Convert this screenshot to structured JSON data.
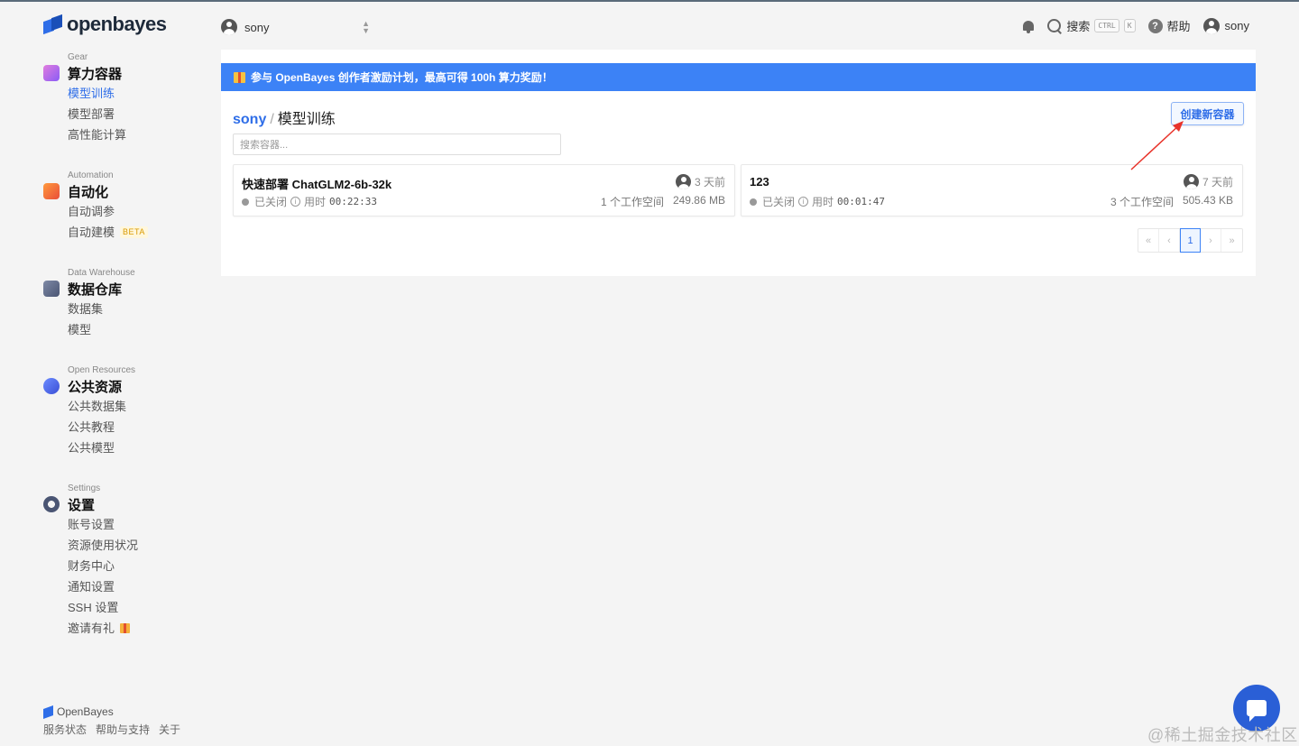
{
  "brand": {
    "name": "openbayes"
  },
  "topbar": {
    "user_switch": "sony",
    "search_label": "搜索",
    "kbd_ctrl": "CTRL",
    "kbd_k": "K",
    "help_label": "帮助",
    "me_label": "sony"
  },
  "sidebar": {
    "gear": {
      "sub": "Gear",
      "title": "算力容器",
      "items": [
        "模型训练",
        "模型部署",
        "高性能计算"
      ]
    },
    "automation": {
      "sub": "Automation",
      "title": "自动化",
      "items": [
        "自动调参",
        "自动建模"
      ],
      "beta": "BETA"
    },
    "warehouse": {
      "sub": "Data Warehouse",
      "title": "数据仓库",
      "items": [
        "数据集",
        "模型"
      ]
    },
    "open": {
      "sub": "Open Resources",
      "title": "公共资源",
      "items": [
        "公共数据集",
        "公共教程",
        "公共模型"
      ]
    },
    "settings": {
      "sub": "Settings",
      "title": "设置",
      "items": [
        "账号设置",
        "资源使用状况",
        "财务中心",
        "通知设置",
        "SSH 设置",
        "邀请有礼"
      ]
    }
  },
  "footer": {
    "brand": "OpenBayes",
    "links": [
      "服务状态",
      "帮助与支持",
      "关于"
    ]
  },
  "banner": {
    "text": "参与 OpenBayes 创作者激励计划，最高可得 100h 算力奖励！"
  },
  "breadcrumb": {
    "owner": "sony",
    "sep": "/",
    "page": "模型训练"
  },
  "create_button": "创建新容器",
  "search": {
    "placeholder": "搜索容器..."
  },
  "containers": [
    {
      "title": "快速部署 ChatGLM2-6b-32k",
      "status": "已关闭",
      "duration_label": "用时",
      "duration": "00:22:33",
      "time": "3 天前",
      "workspaces": "1 个工作空间",
      "size": "249.86 MB"
    },
    {
      "title": "123",
      "status": "已关闭",
      "duration_label": "用时",
      "duration": "00:01:47",
      "time": "7 天前",
      "workspaces": "3 个工作空间",
      "size": "505.43 KB"
    }
  ],
  "pagination": {
    "first": "«",
    "prev": "‹",
    "current": "1",
    "next": "›",
    "last": "»"
  },
  "watermark": "@稀土掘金技术社区",
  "colors": {
    "accent": "#3c82f6",
    "link": "#2f6ee8"
  }
}
